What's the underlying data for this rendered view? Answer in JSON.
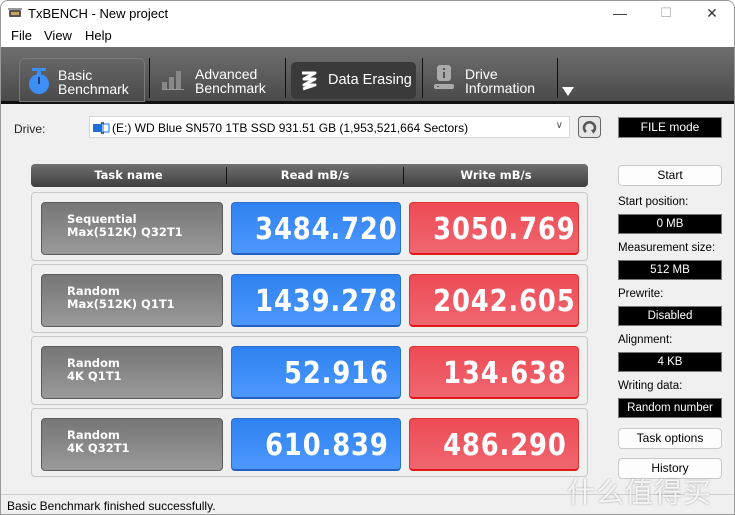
{
  "window": {
    "title": "TxBENCH - New project",
    "controls": {
      "minimize": "—",
      "maximize": "☐",
      "close": "✕"
    }
  },
  "menu": {
    "items": [
      {
        "label": "File"
      },
      {
        "label": "View"
      },
      {
        "label": "Help"
      }
    ]
  },
  "toolbar": {
    "tabs": [
      {
        "label": "Basic\nBenchmark",
        "icon": "stopwatch-icon",
        "active": true
      },
      {
        "label": "Advanced\nBenchmark",
        "icon": "bar-chart-icon",
        "active": false
      },
      {
        "label": "Data Erasing",
        "icon": "eraser-zigzag-icon",
        "active": false
      },
      {
        "label": "Drive\nInformation",
        "icon": "drive-info-icon",
        "active": false
      }
    ],
    "more_icon": "triangle-down-icon"
  },
  "drive": {
    "label": "Drive:",
    "selected": "(E:) WD Blue SN570 1TB SSD  931.51 GB (1,953,521,664 Sectors)",
    "mode": "FILE mode"
  },
  "grid": {
    "headers": [
      "Task name",
      "Read mB/s",
      "Write mB/s"
    ],
    "rows": [
      {
        "task": "Sequential\nMax(512K) Q32T1",
        "read": "3484.720",
        "write": "3050.769"
      },
      {
        "task": "Random\nMax(512K) Q1T1",
        "read": "1439.278",
        "write": "2042.605"
      },
      {
        "task": "Random\n4K Q1T1",
        "read": "52.916",
        "write": "134.638"
      },
      {
        "task": "Random\n4K Q32T1",
        "read": "610.839",
        "write": "486.290"
      }
    ]
  },
  "side": {
    "start_button": "Start",
    "fields": [
      {
        "label": "Start position:",
        "value": "0 MB"
      },
      {
        "label": "Measurement size:",
        "value": "512 MB"
      },
      {
        "label": "Prewrite:",
        "value": "Disabled"
      },
      {
        "label": "Alignment:",
        "value": "4 KB"
      },
      {
        "label": "Writing data:",
        "value": "Random number"
      }
    ],
    "task_options_button": "Task options",
    "history_button": "History"
  },
  "status": {
    "text": "Basic Benchmark finished successfully."
  },
  "watermark": {
    "text": "什么值得买"
  },
  "colors": {
    "read": "#3d8ff7",
    "write": "#ef5560",
    "toolbar": "#5a5a5a"
  }
}
